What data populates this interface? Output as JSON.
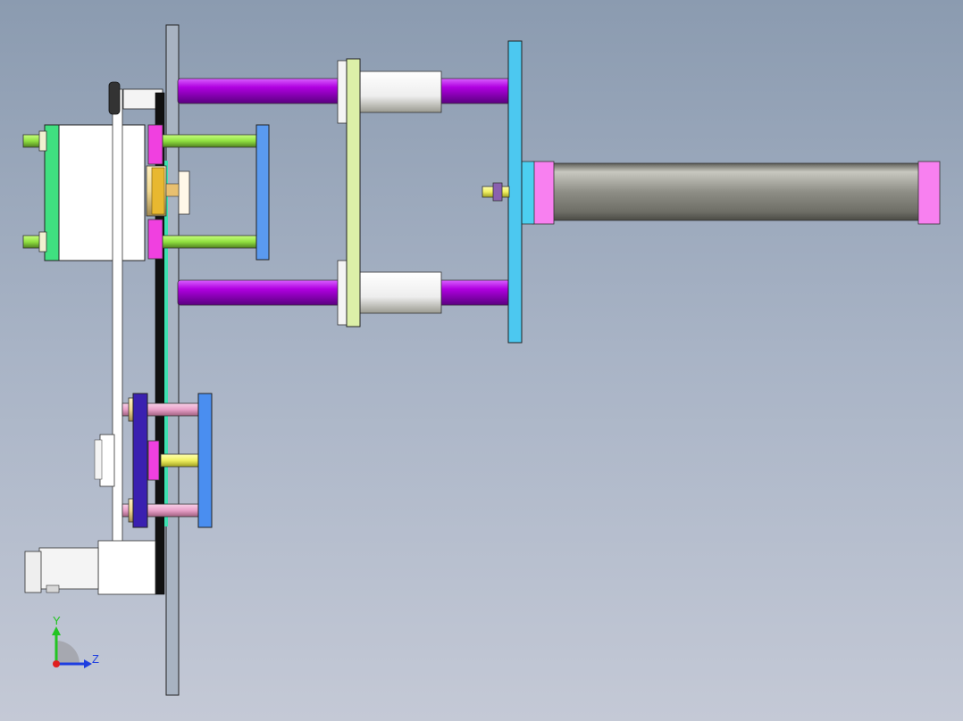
{
  "viewport": {
    "background_top": "#8b9bb0",
    "background_bottom": "#c4c9d6"
  },
  "triad": {
    "y_label": "Y",
    "z_label": "Z",
    "y_color": "#22c422",
    "z_color": "#1e3ee0",
    "x_color": "#e01e1e"
  },
  "parts": {
    "main_plate_color": "#a8b3c2",
    "purple_rod_color": "#b000e0",
    "cyan_plate_color": "#4cc8f0",
    "yellow_green_plate_color": "#dcf0a8",
    "cylinder_color": "#8e8e86",
    "cylinder_cap_color": "#f880f0",
    "blue_plate_color": "#4a8ef0",
    "green_rod_color": "#90e040",
    "magenta_block_color": "#f040e0",
    "indigo_plate_color": "#3a20b0",
    "pink_rod_color": "#e8a0c8",
    "yellow_rod_color": "#f0f060",
    "gear_color": "#e8b830"
  }
}
